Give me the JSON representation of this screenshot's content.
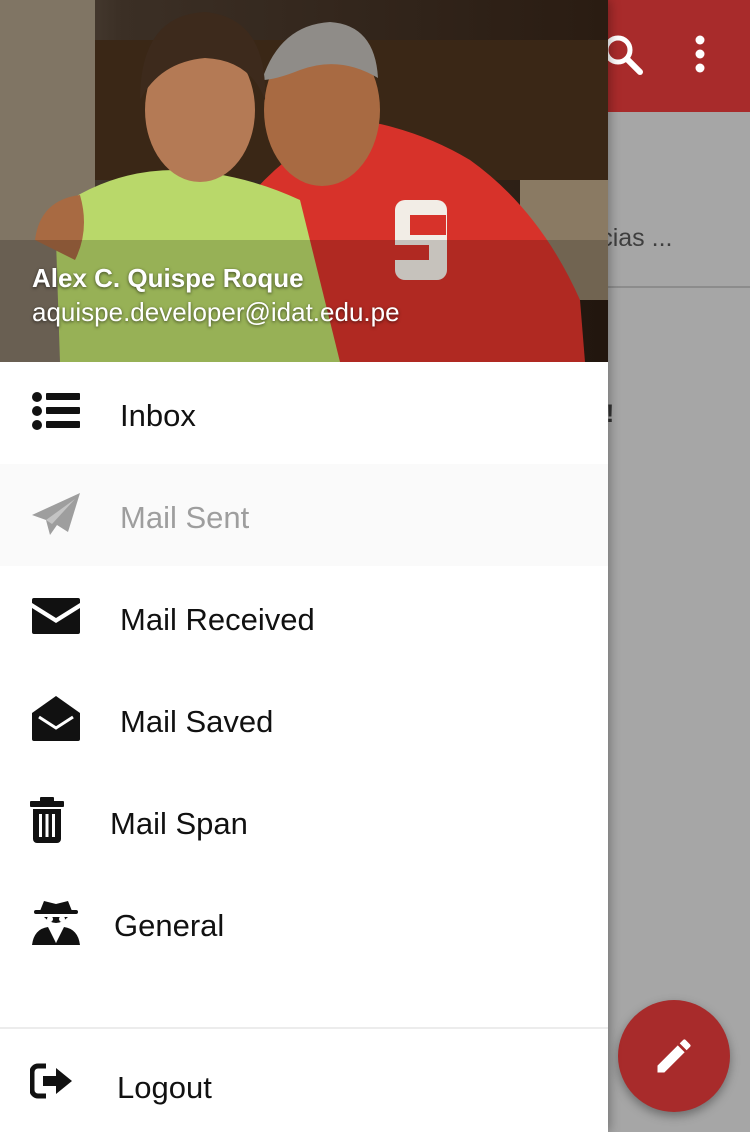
{
  "header": {
    "user_name": "Alex C. Quispe Roque",
    "user_email": "aquispe.developer@idat.edu.pe"
  },
  "menu": {
    "items": [
      {
        "label": "Inbox",
        "icon": "list-icon",
        "active": false
      },
      {
        "label": "Mail Sent",
        "icon": "paper-plane-icon",
        "active": true
      },
      {
        "label": "Mail Received",
        "icon": "envelope-icon",
        "active": false
      },
      {
        "label": "Mail Saved",
        "icon": "envelope-open-icon",
        "active": false
      },
      {
        "label": "Mail Span",
        "icon": "trash-icon",
        "active": false
      },
      {
        "label": "General",
        "icon": "user-secret-icon",
        "active": false
      }
    ],
    "logout_label": "Logout"
  },
  "background": {
    "snippet_text": "racias ...",
    "bold_text": "e!"
  },
  "colors": {
    "primary": "#a82b2b",
    "active_item_bg": "#fafafa",
    "active_text": "#9e9e9e",
    "scrim": "#a6a6a6"
  }
}
